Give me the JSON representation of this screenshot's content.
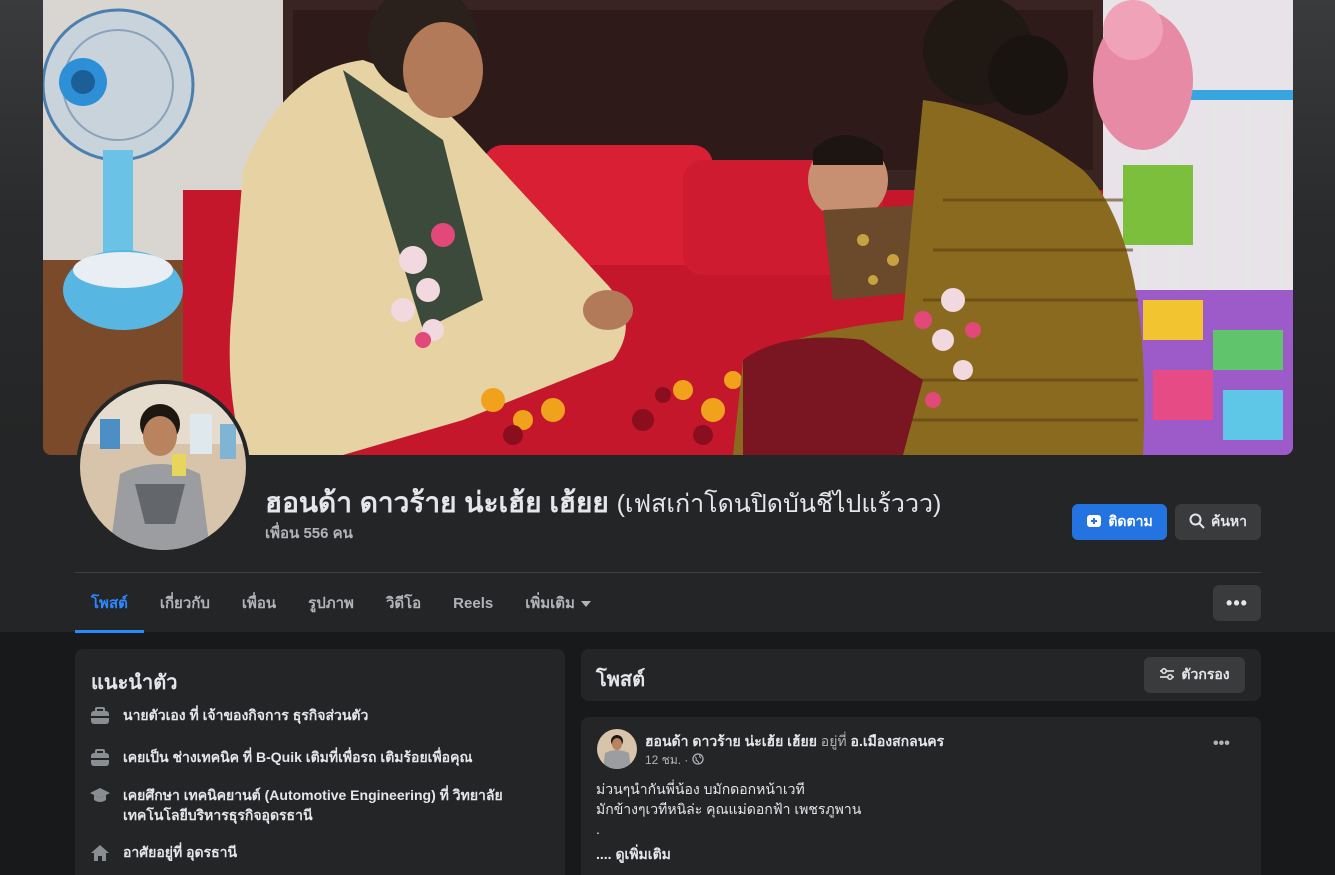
{
  "profile": {
    "name": "ฮอนด้า ดาวร้าย น่ะเฮ้ย เฮ้ยย",
    "alt_name": "(เฟสเก่าโดนปิดบันชีไปแร้ววว)",
    "friends": "เพื่อน 556 คน"
  },
  "actions": {
    "follow_label": "ติดตาม",
    "search_label": "ค้นหา"
  },
  "tabs": [
    {
      "label": "โพสต์"
    },
    {
      "label": "เกี่ยวกับ"
    },
    {
      "label": "เพื่อน"
    },
    {
      "label": "รูปภาพ"
    },
    {
      "label": "วิดีโอ"
    },
    {
      "label": "Reels"
    },
    {
      "label": "เพิ่มเติม"
    }
  ],
  "intro": {
    "title": "แนะนำตัว",
    "items": [
      {
        "icon": "briefcase-icon",
        "text": "นายตัวเอง ที่ เจ้าของกิจการ ธุรกิจส่วนตัว"
      },
      {
        "icon": "briefcase-icon",
        "text": "เคยเป็น ช่างเทคนิค ที่ B-Quik เติมที่เพื่อรถ เติมร้อยเพื่อคุณ"
      },
      {
        "icon": "graduation-cap-icon",
        "text": "เคยศึกษา เทคนิคยานต์ (Automotive Engineering) ที่ วิทยาลัยเทคโนโลยีบริหารธุรกิจอุดรธานี"
      },
      {
        "icon": "home-icon",
        "text": "อาศัยอยู่ที่ อุดรธานี"
      }
    ]
  },
  "posts": {
    "title": "โพสต์",
    "filter_label": "ตัวกรอง"
  },
  "post": {
    "author": "ฮอนด้า ดาวร้าย น่ะเฮ้ย เฮ้ยย",
    "location_prefix": "อยู่ที่",
    "location": "อ.เมืองสกลนคร",
    "time": "12 ชม. ·",
    "lines": [
      "ม่วนๆนำกันพี่น้อง บมักดอกหน้าเวที",
      "มักข้างๆเวทีหนิล่ะ คุณแม่ดอกฟ้า เพชรภูพาน",
      "."
    ],
    "see_more": ".... ดูเพิ่มเติม"
  },
  "colors": {
    "accent": "#2d88ff",
    "follow_button": "#2374e1",
    "card": "#242526",
    "background": "#18191a"
  }
}
